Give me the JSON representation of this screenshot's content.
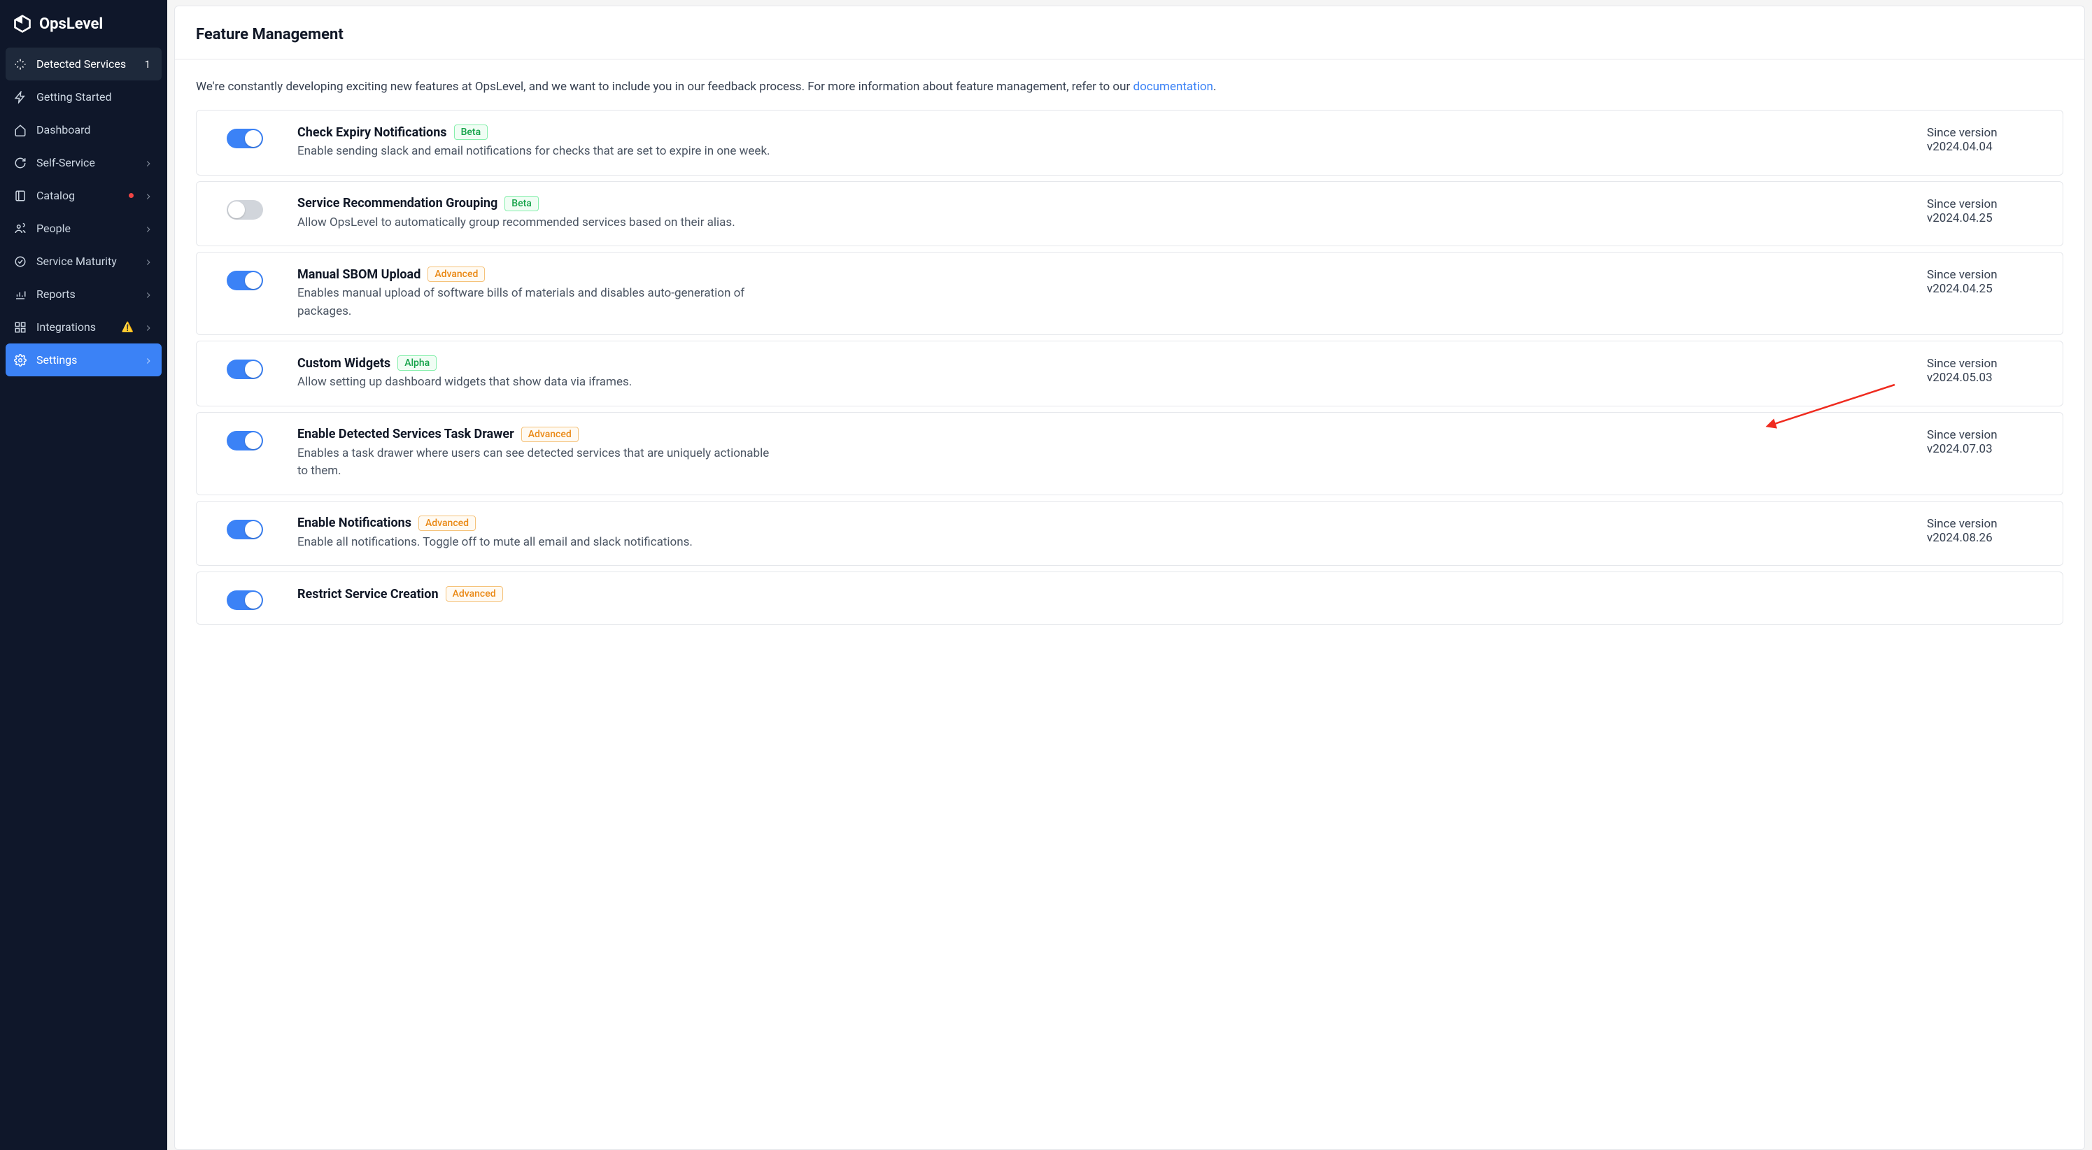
{
  "brand": {
    "name": "OpsLevel"
  },
  "sidebar": {
    "detected": {
      "label": "Detected Services",
      "count": "1"
    },
    "items": [
      {
        "id": "getting-started",
        "label": "Getting Started",
        "chevron": false
      },
      {
        "id": "dashboard",
        "label": "Dashboard",
        "chevron": false
      },
      {
        "id": "self-service",
        "label": "Self-Service",
        "chevron": true
      },
      {
        "id": "catalog",
        "label": "Catalog",
        "chevron": true,
        "dot": true
      },
      {
        "id": "people",
        "label": "People",
        "chevron": true
      },
      {
        "id": "service-maturity",
        "label": "Service Maturity",
        "chevron": true
      },
      {
        "id": "reports",
        "label": "Reports",
        "chevron": true
      },
      {
        "id": "integrations",
        "label": "Integrations",
        "chevron": true,
        "warn": true
      },
      {
        "id": "settings",
        "label": "Settings",
        "chevron": true,
        "active": true
      }
    ]
  },
  "page": {
    "title": "Feature Management",
    "intro_1": "We're constantly developing exciting new features at OpsLevel, and we want to include you in our feedback process. For more information about feature management, refer to our ",
    "doc_link": "documentation",
    "intro_2": "."
  },
  "badges": {
    "beta": "Beta",
    "alpha": "Alpha",
    "advanced": "Advanced"
  },
  "version_label": "Since version",
  "features": [
    {
      "title": "Check Expiry Notifications",
      "badge": "beta",
      "enabled": true,
      "desc": "Enable sending slack and email notifications for checks that are set to expire in one week.",
      "version": "v2024.04.04"
    },
    {
      "title": "Service Recommendation Grouping",
      "badge": "beta",
      "enabled": false,
      "desc": "Allow OpsLevel to automatically group recommended services based on their alias.",
      "version": "v2024.04.25"
    },
    {
      "title": "Manual SBOM Upload",
      "badge": "advanced",
      "enabled": true,
      "desc": "Enables manual upload of software bills of materials and disables auto-generation of packages.",
      "version": "v2024.04.25"
    },
    {
      "title": "Custom Widgets",
      "badge": "alpha",
      "enabled": true,
      "desc": "Allow setting up dashboard widgets that show data via iframes.",
      "version": "v2024.05.03"
    },
    {
      "title": "Enable Detected Services Task Drawer",
      "badge": "advanced",
      "enabled": true,
      "desc": "Enables a task drawer where users can see detected services that are uniquely actionable to them.",
      "version": "v2024.07.03",
      "arrow": true
    },
    {
      "title": "Enable Notifications",
      "badge": "advanced",
      "enabled": true,
      "desc": "Enable all notifications. Toggle off to mute all email and slack notifications.",
      "version": "v2024.08.26"
    },
    {
      "title": "Restrict Service Creation",
      "badge": "advanced",
      "enabled": true,
      "desc": "",
      "version": ""
    }
  ]
}
